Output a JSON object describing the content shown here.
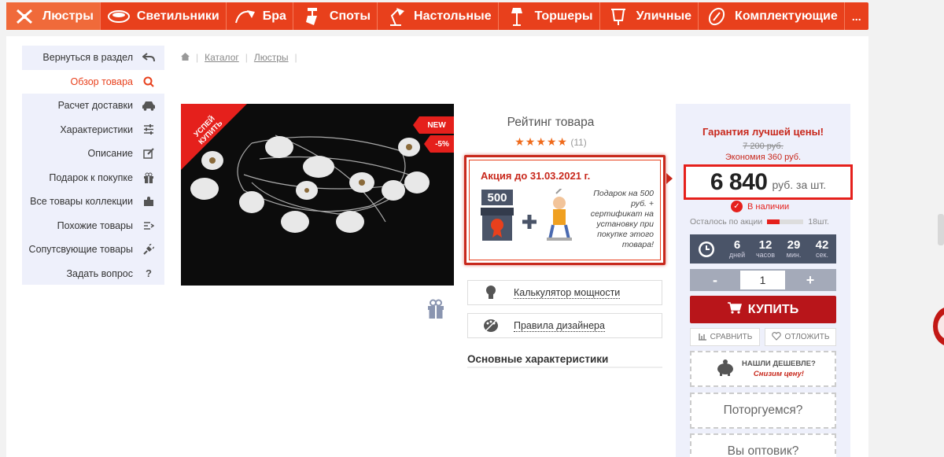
{
  "nav": {
    "items": [
      {
        "label": "Люстры",
        "icon": "chandelier-icon"
      },
      {
        "label": "Светильники",
        "icon": "ceiling-lamp-icon"
      },
      {
        "label": "Бра",
        "icon": "sconce-icon"
      },
      {
        "label": "Споты",
        "icon": "spot-icon"
      },
      {
        "label": "Настольные",
        "icon": "desk-lamp-icon"
      },
      {
        "label": "Торшеры",
        "icon": "floor-lamp-icon"
      },
      {
        "label": "Уличные",
        "icon": "street-lamp-icon"
      },
      {
        "label": "Комплектующие",
        "icon": "component-icon"
      }
    ],
    "more_label": "..."
  },
  "sidebar": {
    "items": [
      {
        "label": "Вернуться в раздел",
        "icon": "back-arrow-icon"
      },
      {
        "label": "Обзор товара",
        "icon": "search-icon"
      },
      {
        "label": "Расчет доставки",
        "icon": "car-icon"
      },
      {
        "label": "Характеристики",
        "icon": "sliders-icon"
      },
      {
        "label": "Описание",
        "icon": "edit-icon"
      },
      {
        "label": "Подарок к покупке",
        "icon": "gift-icon"
      },
      {
        "label": "Все товары коллекции",
        "icon": "puzzle-icon"
      },
      {
        "label": "Похожие товары",
        "icon": "compare-icon"
      },
      {
        "label": "Сопутсвующие товары",
        "icon": "plug-icon"
      },
      {
        "label": "Задать вопрос",
        "icon": "question-icon"
      }
    ]
  },
  "breadcrumb": {
    "home_icon": "home-icon",
    "items": [
      "Каталог",
      "Люстры"
    ]
  },
  "product_image": {
    "ribbon": "УСПЕЙ КУПИТЬ",
    "badge_new": "NEW",
    "badge_discount": "-5%"
  },
  "rating": {
    "title": "Рейтинг товара",
    "stars": "★★★★★",
    "count": "(11)"
  },
  "promo": {
    "title": "Акция до 31.03.2021 г.",
    "amount": "500",
    "text": "Подарок на 500 руб. + сертификат на установку при покупке этого товара!"
  },
  "tools": {
    "calculator": "Калькулятор мощности",
    "designer": "Правила дизайнера"
  },
  "specs_title": "Основные характеристики",
  "price": {
    "best_price": "Гарантия лучшей цены!",
    "old_price": "7 200 руб.",
    "economy": "Экономия 360 руб.",
    "value": "6 840",
    "unit": "руб. за шт.",
    "stock": "В наличии",
    "remain_label": "Осталось по акции",
    "remain_count": "18шт.",
    "remain_fraction": 0.35
  },
  "timer": {
    "days": "6",
    "days_label": "дней",
    "hours": "12",
    "hours_label": "часов",
    "minutes": "29",
    "minutes_label": "мин.",
    "seconds": "42",
    "seconds_label": "сек."
  },
  "quantity": {
    "minus": "-",
    "value": "1",
    "plus": "+"
  },
  "buttons": {
    "buy": "КУПИТЬ",
    "compare": "СРАВНИТЬ",
    "postpone": "ОТЛОЖИТЬ",
    "cheaper_q": "НАШЛИ ДЕШЕВЛЕ?",
    "cheaper_a": "Снизим цену!",
    "bargain": "Поторгуемся?",
    "wholesale": "Вы оптовик?"
  },
  "colors": {
    "accent": "#e8401c",
    "buy": "#b8151a",
    "panel": "#eef0fb"
  }
}
